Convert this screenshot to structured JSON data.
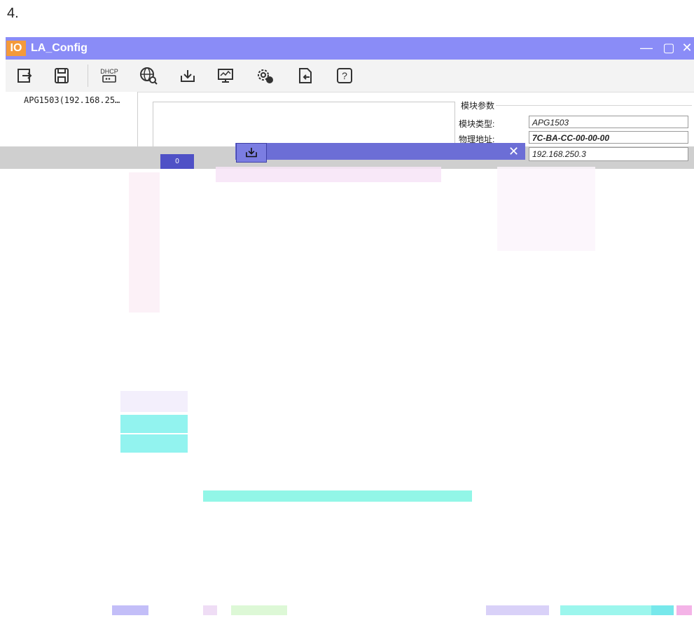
{
  "step_label": "4.",
  "app": {
    "logo": "IO",
    "title": "LA_Config",
    "window_controls": [
      "—",
      "▢",
      "✕"
    ]
  },
  "toolbar": {
    "icons": [
      "open-icon",
      "save-icon",
      "dhcp-icon",
      "network-search-icon",
      "download-icon",
      "monitor-icon",
      "settings-icon",
      "export-icon",
      "help-icon"
    ],
    "dhcp_label": "DHCP",
    "help_label": "?"
  },
  "device_tree": {
    "items": [
      "APG1503(192.168.25…"
    ]
  },
  "module_params": {
    "group_title": "模块参数",
    "type_label": "模块类型:",
    "type_value": "APG1503",
    "mac_label": "物理地址:",
    "mac_value": "7C-BA-CC-00-00-00",
    "ip_value": "192.168.250.3"
  },
  "download_dialog": {
    "close_label": "✕",
    "button_label": "0"
  },
  "colors": {
    "titlebar": "#8a8cf7",
    "logo": "#f49a3b",
    "dialog": "#6c6ed6",
    "artifact_cyan": "#7ff5e3"
  }
}
